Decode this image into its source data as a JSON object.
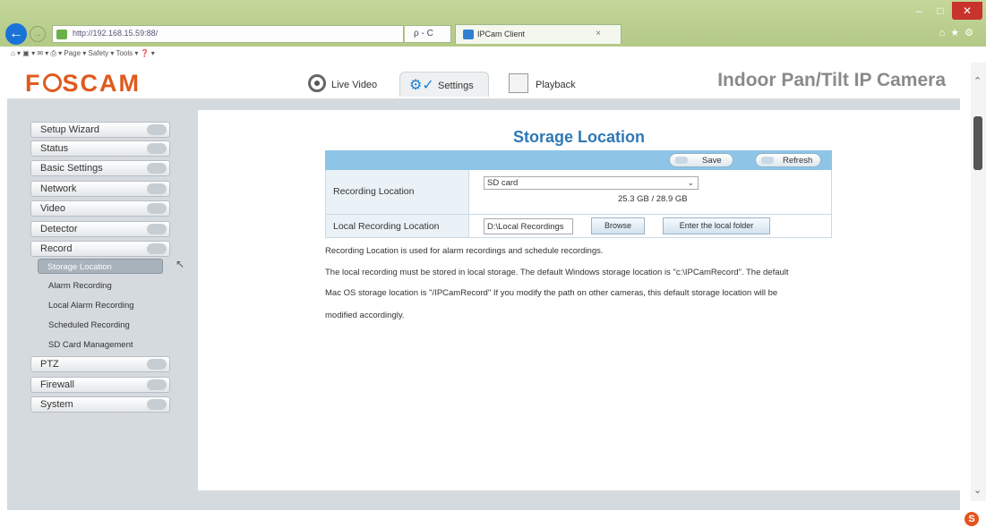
{
  "browser": {
    "url": "http://192.168.15.59:88/",
    "address_tools": "ρ - C",
    "tab_title": "IPCam Client",
    "tab_close": "×",
    "command_bar": "⌂ ▾ ▣ ▾ ✉ ▾ ⎙ ▾  Page ▾  Safety ▾  Tools ▾  ❓ ▾",
    "right_icons": "⌂★⚙",
    "win_min": "–",
    "win_max": "□",
    "win_close": "✕"
  },
  "header": {
    "logo_pre": "F",
    "logo_post": "SCAM",
    "product_title": "Indoor Pan/Tilt IP Camera",
    "nav": {
      "live_video": "Live Video",
      "settings": "Settings",
      "playback": "Playback"
    }
  },
  "sidebar": {
    "menus": {
      "setup_wizard": "Setup Wizard",
      "status": "Status",
      "basic_settings": "Basic Settings",
      "network": "Network",
      "video": "Video",
      "detector": "Detector",
      "record": "Record",
      "ptz": "PTZ",
      "firewall": "Firewall",
      "system": "System"
    },
    "record_sub": {
      "storage_location": "Storage Location",
      "alarm_recording": "Alarm Recording",
      "local_alarm_recording": "Local Alarm Recording",
      "scheduled_recording": "Scheduled Recording",
      "sd_card_management": "SD Card Management"
    }
  },
  "main": {
    "title": "Storage Location",
    "save_label": "Save",
    "refresh_label": "Refresh",
    "recording_location_label": "Recording Location",
    "recording_location_value": "SD card",
    "capacity": "25.3 GB / 28.9 GB",
    "local_recording_label": "Local Recording Location",
    "local_path_value": "D:\\Local Recordings",
    "browse_label": "Browse",
    "enter_folder_label": "Enter the local folder",
    "note1": "Recording Location is used for alarm recordings and schedule recordings.",
    "note2": "The local recording must be stored in local storage. The default Windows storage location is \"c:\\IPCamRecord\". The default",
    "note3": "Mac OS storage location is \"/IPCamRecord\" If you modify the path on other cameras, this default storage location will be",
    "note4": "modified accordingly."
  },
  "colors": {
    "logo": "#e05a1c",
    "title_blue": "#2f78b6",
    "form_header": "#8ec5e6",
    "browser_chrome": "#b3c986"
  }
}
